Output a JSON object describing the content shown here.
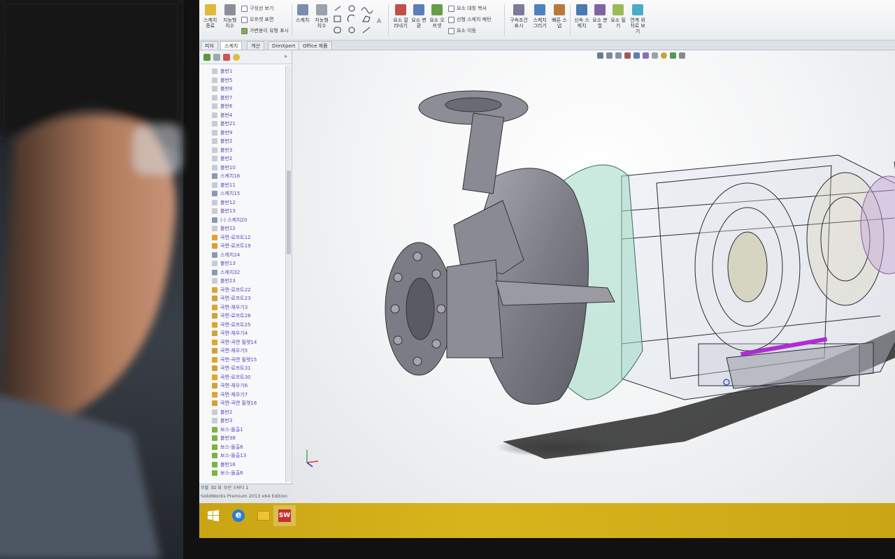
{
  "window": {
    "app": "SolidWorks"
  },
  "ribbon": {
    "groups": [
      {
        "label": "스케치",
        "color": "#7a8fb0"
      },
      {
        "label": "지능형 치수",
        "color": "#9aa3ad"
      },
      {
        "label": "요소 잘라내기",
        "color": "#c0504d"
      },
      {
        "label": "요소 변환",
        "color": "#5b7fb5"
      },
      {
        "label": "요소 오프셋",
        "color": "#6a9a4a"
      },
      {
        "label": "구속조건 표시",
        "color": "#7b7b9a"
      },
      {
        "label": "스케치 그리기",
        "color": "#4f81bd"
      },
      {
        "label": "빠른 스냅",
        "color": "#b57a3a"
      },
      {
        "label": "신속 스케치",
        "color": "#4a7ab0"
      },
      {
        "label": "요소 분할",
        "color": "#8064a2"
      },
      {
        "label": "요소 밀기",
        "color": "#9bbb59"
      },
      {
        "label": "연계 위치로 보기",
        "color": "#4bacc6"
      }
    ],
    "left_items": [
      {
        "label": "구성선 보기"
      },
      {
        "label": "오프셋 표면"
      },
      {
        "label": "가변용이 유형 표시"
      }
    ],
    "mid_items": [
      {
        "label": "요소 대칭 복사"
      },
      {
        "label": "선형 스케치 패턴"
      },
      {
        "label": "요소 이동"
      }
    ]
  },
  "tabs": [
    {
      "label": "피처",
      "active": false
    },
    {
      "label": "스케치",
      "active": true
    },
    {
      "label": "계산",
      "active": false
    },
    {
      "label": "DimXpert",
      "active": false
    },
    {
      "label": "Office 제품",
      "active": false
    }
  ],
  "tree": {
    "items": [
      "볼반1",
      "볼반5",
      "볼반8",
      "볼반7",
      "볼반6",
      "볼반4",
      "볼반21",
      "볼반9",
      "볼반2",
      "볼반3",
      "볼반2",
      "볼반10",
      "스케치16",
      "볼반11",
      "스케치15",
      "볼반12",
      "볼반13",
      "(-) 스케치20",
      "볼반22",
      "곡면-로프트12",
      "곡면-로프트19",
      "스케치24",
      "볼반13",
      "스케치32",
      "볼반23",
      "곡면-로프트22",
      "곡면-로프트23",
      "곡면-채우기3",
      "곡면-로프트28",
      "곡면-로프트25",
      "곡면-채우기4",
      "곡면-곡면 필렛14",
      "곡면-채우기5",
      "곡면-곡면 필렛15",
      "곡면-로프트31",
      "곡면-로프트30",
      "곡면-채우기6",
      "곡면-채우기7",
      "곡면-곡면 필렛16",
      "볼반2",
      "볼반3",
      "보스-돌출1",
      "볼반38",
      "보스-돌출6",
      "보스-돌출13",
      "볼반16",
      "보스-돌출6"
    ]
  },
  "statusbar": {
    "tabs": [
      "모델",
      "3D 뷰",
      "모션 스터디 1"
    ],
    "edition": "SolidWorks Premium 2013 x64 Edition"
  },
  "taskbar": {
    "items": [
      "start",
      "ie",
      "explorer",
      "solidworks"
    ]
  },
  "colors": {
    "taskbar": "#d8b41c",
    "tree_text": "#5b44b8",
    "part_grey": "#8a8a94"
  }
}
